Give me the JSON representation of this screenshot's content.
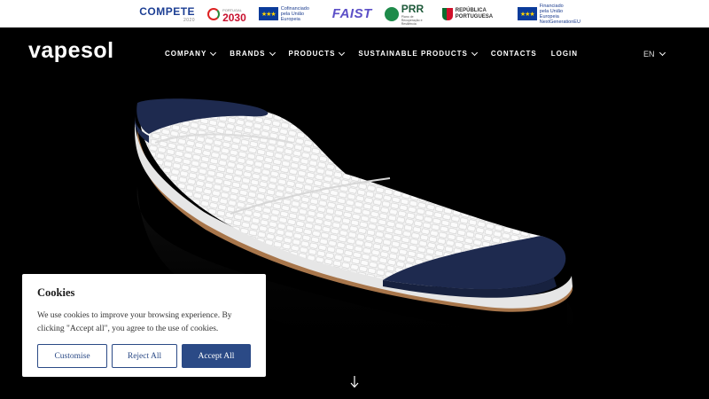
{
  "funding_logos": {
    "compete": "COMPETE",
    "compete_sub": "2020",
    "portugal2030_a": "PORTUGAL",
    "portugal2030_b": "2030",
    "eu_cofin": "Cofinanciado pela União Europeia",
    "faist": "FAIST",
    "prr": "PRR",
    "prr_sub": "Plano de Recuperação e Resiliência",
    "republica": "REPÚBLICA PORTUGUESA",
    "eu_nextgen": "Financiado pela União Europeia NextGenerationEU"
  },
  "header": {
    "brand": "vapesol",
    "nav": [
      {
        "label": "COMPANY",
        "has_dropdown": true
      },
      {
        "label": "BRANDS",
        "has_dropdown": true
      },
      {
        "label": "PRODUCTS",
        "has_dropdown": true
      },
      {
        "label": "SUSTAINABLE PRODUCTS",
        "has_dropdown": true
      },
      {
        "label": "CONTACTS",
        "has_dropdown": false
      },
      {
        "label": "LOGIN",
        "has_dropdown": false
      }
    ],
    "language": "EN"
  },
  "hero": {
    "image": "insole-sole-product-render",
    "scroll_icon": "arrow-down-icon"
  },
  "cookie_banner": {
    "title": "Cookies",
    "text": "We use cookies to improve your browsing experience. By clicking \"Accept all\", you agree to the use of cookies.",
    "customise": "Customise",
    "reject": "Reject All",
    "accept": "Accept All"
  },
  "colors": {
    "background": "#000000",
    "button_blue": "#2b4a86",
    "insole_navy": "#1e2a4f",
    "insole_white": "#eeeeee",
    "cork": "#a8764b"
  }
}
